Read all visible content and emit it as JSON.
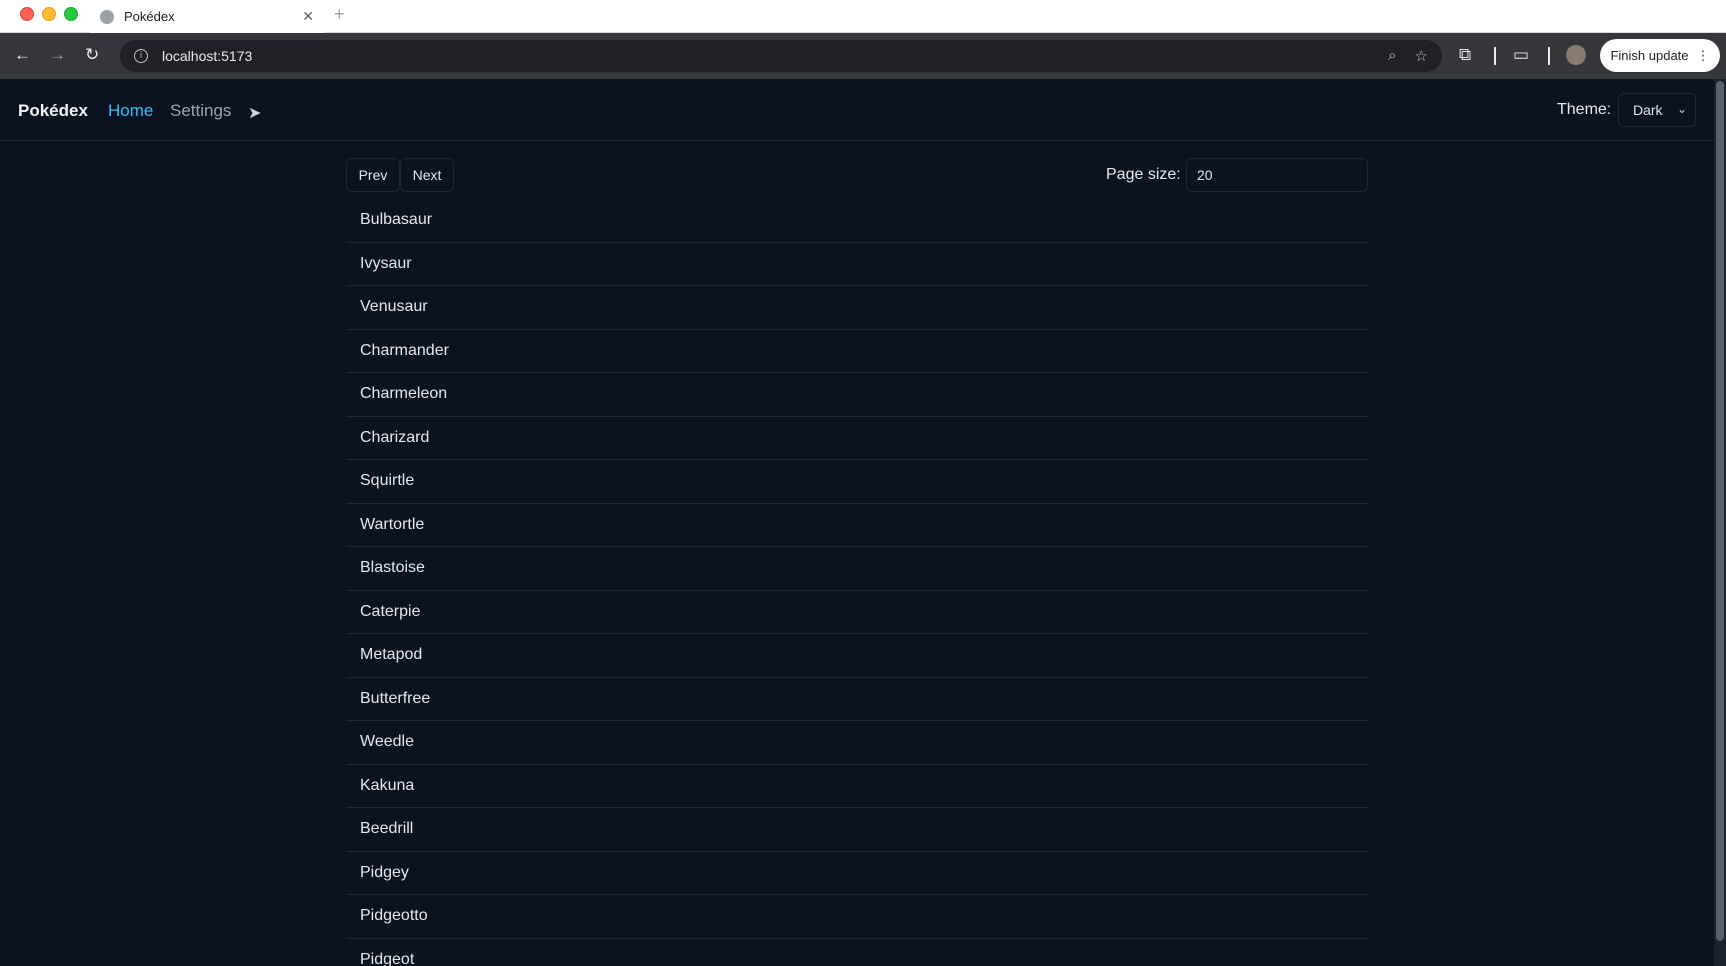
{
  "browser": {
    "tab_title": "Pokédex",
    "url": "localhost:5173",
    "finish_update_label": "Finish update"
  },
  "app": {
    "brand": "Pokédex",
    "nav": {
      "home_label": "Home",
      "settings_label": "Settings"
    },
    "theme": {
      "label": "Theme:",
      "selected": "Dark"
    },
    "pagination": {
      "prev_label": "Prev",
      "next_label": "Next",
      "page_size_label": "Page size:",
      "page_size_value": "20"
    },
    "pokemon": [
      "Bulbasaur",
      "Ivysaur",
      "Venusaur",
      "Charmander",
      "Charmeleon",
      "Charizard",
      "Squirtle",
      "Wartortle",
      "Blastoise",
      "Caterpie",
      "Metapod",
      "Butterfree",
      "Weedle",
      "Kakuna",
      "Beedrill",
      "Pidgey",
      "Pidgeotto",
      "Pidgeot"
    ]
  },
  "colors": {
    "page_background": "#0b1220",
    "accent": "#38bdf8",
    "border": "#1f2937"
  }
}
